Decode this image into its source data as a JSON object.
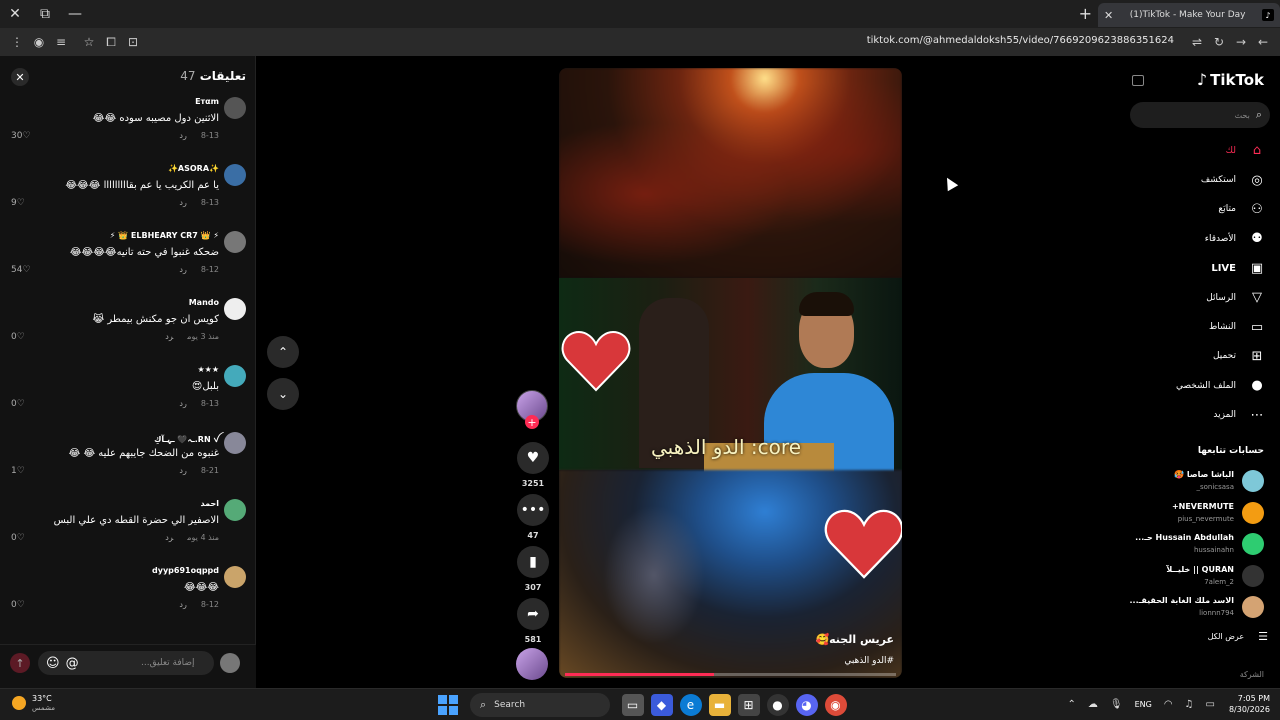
{
  "browser": {
    "tab_title": "(1)TikTok - Make Your Day",
    "url": "tiktok.com/@ahmedaldoksh55/video/7669209623886351624"
  },
  "comments": {
    "title": "تعليقات",
    "count": "47",
    "items": [
      {
        "user": "Eтαm",
        "text": "الاثنين دول مصيبه سوده 😂😂",
        "date": "8-13",
        "reply": "رد",
        "likes": "30"
      },
      {
        "user": "✨ASORA✨",
        "text": "يا عم الكريب يا عم بقااااااااا 😂😂😂",
        "date": "8-13",
        "reply": "رد",
        "likes": "9"
      },
      {
        "user": "⚡ 👑 ELBHEARY CR7 👑 ⚡",
        "text": "ضحكه غنبوا في حته تانيه😂😂😂😂",
        "date": "8-12",
        "reply": "رد",
        "likes": "54"
      },
      {
        "user": "Mando",
        "text": "كويس ان جو مكنش بيمطر 😹",
        "date": "منذ 3 يوم",
        "reply": "رد",
        "likes": "0"
      },
      {
        "user": "★★★",
        "text": "بلبل😍",
        "date": "8-13",
        "reply": "رد",
        "likes": "0"
      },
      {
        "user": "RN ꪜ.ـہ🖤 ـہـآكِ",
        "text": "غنبوه من الضحك جايبهم عليه 😂 😂",
        "date": "8-21",
        "reply": "رد",
        "likes": "1"
      },
      {
        "user": "احمد",
        "text": "الاصفير الي حضرة القطه دي علي البس",
        "date": "منذ 4 يوم",
        "reply": "رد",
        "likes": "0"
      },
      {
        "user": "dyyp691oqppd",
        "text": "😂😂😂",
        "date": "8-12",
        "reply": "رد",
        "likes": "0"
      }
    ],
    "input_placeholder": "إضافة تعليق..."
  },
  "video": {
    "caption_overlay": "الدو الذهبي :core",
    "desc_user": "عريس الجنه🥰",
    "desc_tag": "#الدو الذهبي",
    "progress": 0.45,
    "likes": "3251",
    "comments": "47",
    "saves": "307",
    "shares": "581"
  },
  "sidebar": {
    "logo": "TikTok",
    "search_placeholder": "بحث",
    "nav": [
      {
        "label": "لك",
        "icon": "home-icon",
        "glyph": "⌂",
        "active": true
      },
      {
        "label": "استكشف",
        "icon": "compass-icon",
        "glyph": "◎",
        "active": false
      },
      {
        "label": "متابَع",
        "icon": "user-follow-icon",
        "glyph": "⚇",
        "active": false
      },
      {
        "label": "الأصدقاء",
        "icon": "friends-icon",
        "glyph": "⚉",
        "active": false
      },
      {
        "label": "LIVE",
        "icon": "live-icon",
        "glyph": "▣",
        "active": false
      },
      {
        "label": "الرسائل",
        "icon": "messages-icon",
        "glyph": "▽",
        "active": false
      },
      {
        "label": "النشاط",
        "icon": "activity-icon",
        "glyph": "▭",
        "active": false
      },
      {
        "label": "تحميل",
        "icon": "upload-icon",
        "glyph": "⊞",
        "active": false
      },
      {
        "label": "الملف الشخصي",
        "icon": "profile-icon",
        "glyph": "●",
        "active": false
      },
      {
        "label": "المزيد",
        "icon": "more-icon",
        "glyph": "⋯",
        "active": false
      }
    ],
    "following_title": "حسابات تتابعها",
    "following": [
      {
        "name": "الباشا صاصا 🥵",
        "handle": "_sonicsasa"
      },
      {
        "name": "NEVERMUTE+",
        "handle": "pius_nevermute"
      },
      {
        "name": "Hussain Abdullah حـ...",
        "handle": "hussainahn"
      },
      {
        "name": "QURAN || خليــﻶ",
        "handle": "7alem_2"
      },
      {
        "name": "الاسد ملك الغابة الحقيقـ...",
        "handle": "lionnn794"
      }
    ],
    "see_all": "عرض الكل",
    "company": "الشركة"
  },
  "taskbar": {
    "temp": "33°C",
    "weather_desc": "مشمس",
    "search_label": "Search",
    "lang": "ENG",
    "time": "7:05 PM",
    "date": "8/30/2026"
  }
}
